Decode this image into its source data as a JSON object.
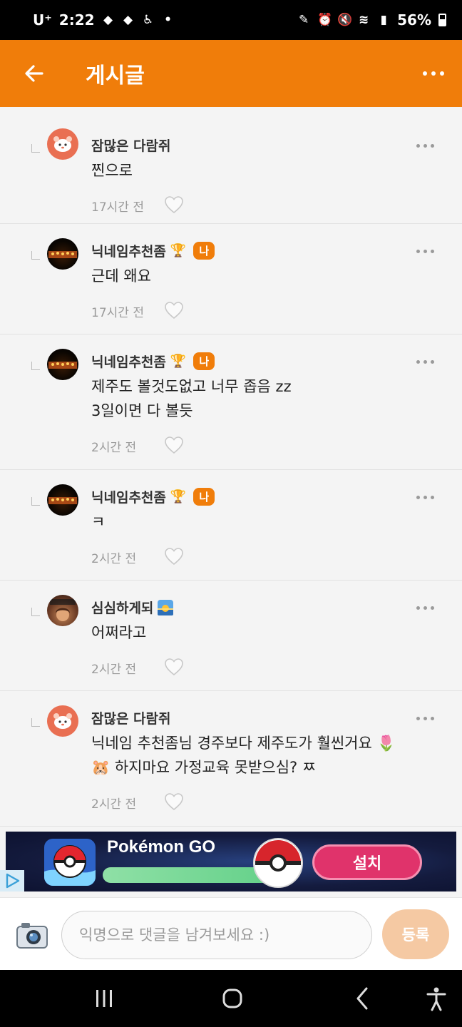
{
  "status_bar": {
    "carrier": "U⁺",
    "time": "2:22",
    "battery": "56%"
  },
  "header": {
    "title": "게시글"
  },
  "comments": [
    {
      "author": "잠많은 다람쥐",
      "text": "찐으로",
      "time": "17시간 전",
      "avatar": "hamster",
      "trophy": false,
      "me_badge": false,
      "emoji": ""
    },
    {
      "author": "닉네임추천좀",
      "text": "근데 왜요",
      "time": "17시간 전",
      "avatar": "dark",
      "trophy": true,
      "me_badge": true,
      "emoji": ""
    },
    {
      "author": "닉네임추천좀",
      "text": "제주도 볼것도없고 너무 좁음 zz\n3일이면 다 볼듯",
      "time": "2시간 전",
      "avatar": "dark",
      "trophy": true,
      "me_badge": true,
      "emoji": ""
    },
    {
      "author": "닉네임추천좀",
      "text": "ㅋ",
      "time": "2시간 전",
      "avatar": "dark",
      "trophy": true,
      "me_badge": true,
      "emoji": ""
    },
    {
      "author": "심심하게되",
      "text": "어쩌라고",
      "time": "2시간 전",
      "avatar": "girl",
      "trophy": false,
      "me_badge": false,
      "emoji": "sunrise"
    },
    {
      "author": "잠많은 다람쥐",
      "text": "닉네임 추천좀님 경주보다 제주도가 훨씬거요 🌷\n🐹 하지마요 가정교육 못받으심? ㅉ",
      "time": "2시간 전",
      "avatar": "hamster",
      "trophy": false,
      "me_badge": false,
      "emoji": ""
    }
  ],
  "labels": {
    "me_badge": "나"
  },
  "ad": {
    "title": "Pokémon GO",
    "install": "설치"
  },
  "input": {
    "placeholder": "익명으로 댓글을 남겨보세요 :)",
    "submit": "등록"
  },
  "colors": {
    "accent": "#f07d0a",
    "submit_disabled": "#f5c9a3"
  }
}
